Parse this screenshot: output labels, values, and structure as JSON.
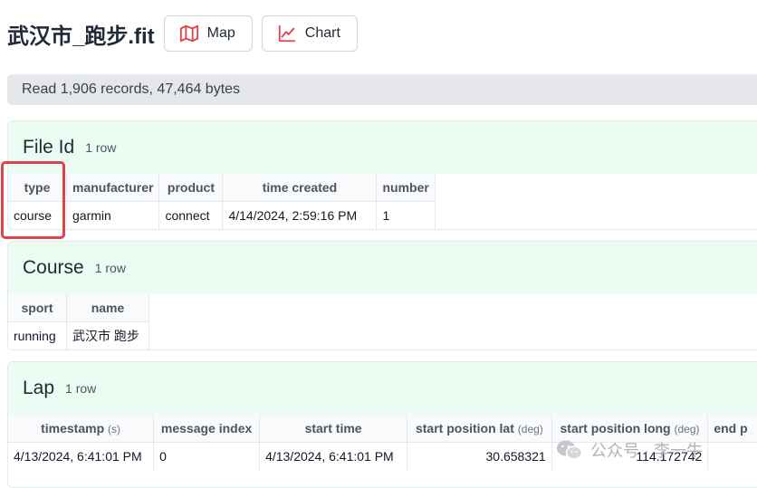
{
  "header": {
    "title": "武汉市_跑步.fit",
    "map_label": "Map",
    "chart_label": "Chart",
    "accent_color": "#e0414a"
  },
  "status": {
    "text": "Read 1,906 records, 47,464 bytes"
  },
  "sections": {
    "file_id": {
      "title": "File Id",
      "count": "1 row",
      "columns": [
        "type",
        "manufacturer",
        "product",
        "time created",
        "number"
      ],
      "row": [
        "course",
        "garmin",
        "connect",
        "4/14/2024, 2:59:16 PM",
        "1"
      ]
    },
    "course": {
      "title": "Course",
      "count": "1 row",
      "columns": [
        "sport",
        "name"
      ],
      "row": [
        "running",
        "武汉市 跑步"
      ]
    },
    "lap": {
      "title": "Lap",
      "count": "1 row",
      "columns": [
        {
          "label": "timestamp",
          "unit": "(s)"
        },
        {
          "label": "message index",
          "unit": ""
        },
        {
          "label": "start time",
          "unit": ""
        },
        {
          "label": "start position lat",
          "unit": "(deg)"
        },
        {
          "label": "start position long",
          "unit": "(deg)"
        },
        {
          "label": "end p",
          "unit": ""
        }
      ],
      "row": [
        "4/13/2024, 6:41:01 PM",
        "0",
        "4/13/2024, 6:41:01 PM",
        "30.658321",
        "114.172742",
        ""
      ]
    }
  },
  "watermark": {
    "text": "公众号 · 李一牛"
  }
}
